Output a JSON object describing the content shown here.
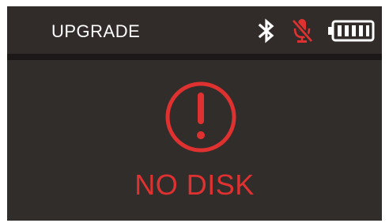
{
  "header": {
    "title": "UPGRADE",
    "icons": [
      "bluetooth-icon",
      "microphone-muted-icon",
      "battery-full-icon"
    ],
    "battery_level": 1.0
  },
  "main": {
    "alert_icon": "exclamation-circle-icon",
    "message": "NO DISK"
  },
  "colors": {
    "background": "#2e2a28",
    "text": "#ffffff",
    "alert": "#e03131"
  }
}
